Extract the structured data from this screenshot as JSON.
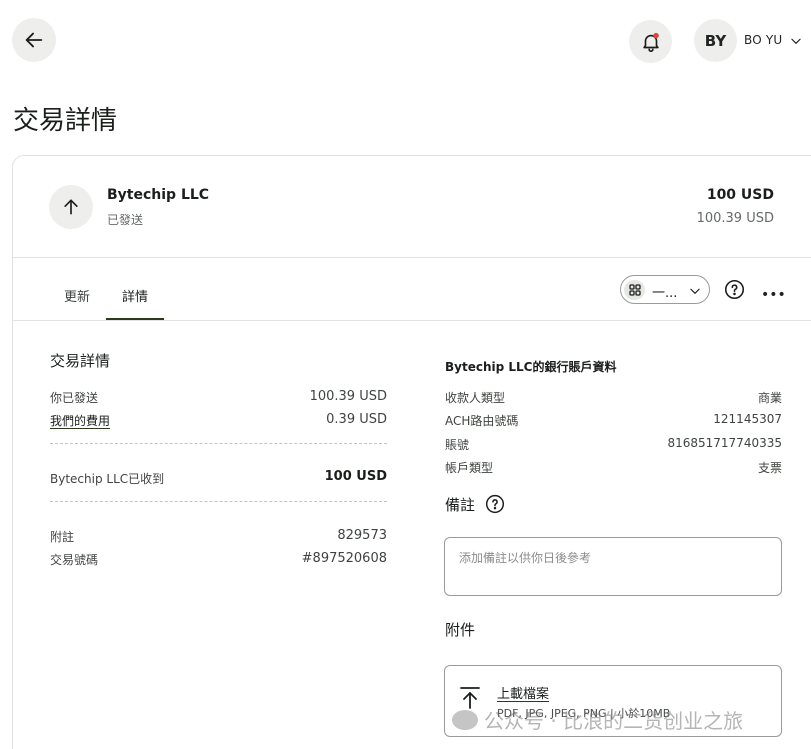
{
  "header": {
    "user_initials": "BY",
    "user_name": "BO YU",
    "notification_dot_color": "#e0443a"
  },
  "page_title": "交易詳情",
  "transaction": {
    "merchant": "Bytechip LLC",
    "status": "已發送",
    "amount": "100 USD",
    "amount_sent": "100.39 USD"
  },
  "tabs": [
    {
      "label": "更新"
    },
    {
      "label": "詳情"
    }
  ],
  "view_select": {
    "value": "一..."
  },
  "details": {
    "title": "交易詳情",
    "sent_label": "你已發送",
    "sent_value": "100.39 USD",
    "fee_label": "我們的費用",
    "fee_value": "0.39 USD",
    "received_label": "Bytechip LLC已收到",
    "received_value": "100 USD",
    "reference_label": "附註",
    "reference_value": "829573",
    "tx_number_label": "交易號碼",
    "tx_number_value": "#897520608"
  },
  "bank": {
    "title": "Bytechip LLC的銀行賬戶資料",
    "rows": [
      {
        "label": "收款人類型",
        "value": "商業"
      },
      {
        "label": "ACH路由號碼",
        "value": "121145307"
      },
      {
        "label": "賬號",
        "value": "816851717740335"
      },
      {
        "label": "帳戶類型",
        "value": "支票"
      }
    ]
  },
  "notes": {
    "title": "備註",
    "placeholder": "添加備註以供你日後參考"
  },
  "attachments": {
    "title": "附件",
    "upload_label": "上載檔案",
    "upload_hint": "PDF, JPG, JPEG, PNG | 小於10MB"
  },
  "watermark": "公众号 · 比浪的二货创业之旅"
}
